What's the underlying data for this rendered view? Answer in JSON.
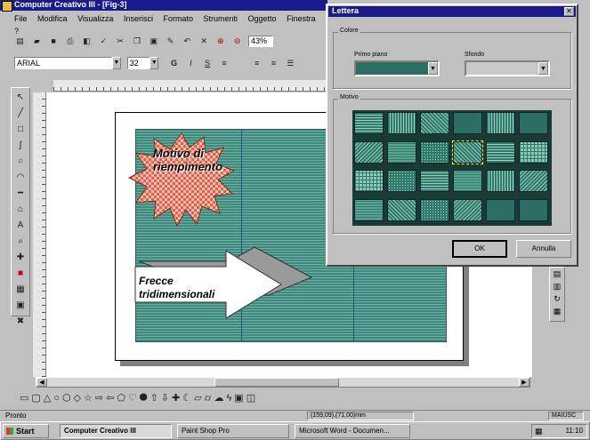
{
  "app": {
    "title": "Computer Creativo III - [Fig-3]",
    "menu": [
      "File",
      "Modifica",
      "Visualizza",
      "Inserisci",
      "Formato",
      "Strumenti",
      "Oggetto",
      "Finestra",
      "?"
    ],
    "zoom": "43%",
    "font_name": "ARIAL",
    "font_size": "32",
    "format_buttons": [
      "G",
      "I",
      "S"
    ]
  },
  "canvas": {
    "callout_text": "Motivo di riempimento",
    "arrow_text": "Frecce tridimensionali"
  },
  "dialog": {
    "title": "Lettera",
    "colors_group": "Colore",
    "foreground_label": "Primo piano",
    "background_label": "Sfondo",
    "pattern_group": "Motivo",
    "ok_label": "OK",
    "cancel_label": "Annulla",
    "patterns": [
      "p1",
      "p2",
      "p3",
      "p4",
      "p2",
      "p4",
      "p5",
      "p6",
      "p7",
      "p3",
      "p1",
      "p8",
      "p8",
      "p7",
      "p1",
      "p6",
      "p2",
      "p5",
      "p6",
      "p3",
      "p7",
      "p5",
      "p4",
      "p4"
    ]
  },
  "statusbar": {
    "left": "Pronto",
    "coords": "(159,09),(71,00)mm",
    "mode": "MAIUSC"
  },
  "taskbar": {
    "start_label": "Start",
    "tasks": [
      "Computer Creativo III",
      "Paint Shop Pro",
      "Microsoft Word - Documen..."
    ],
    "clock": "11:10"
  },
  "colors": {
    "title_bar": "#1a1a8c",
    "canvas_teal": "#4f9a8c",
    "dialog_selected": "#6f9ee8"
  },
  "icons": {
    "ruler": "ruler-icon",
    "draw_tools": [
      "pointer-icon",
      "line-icon",
      "rectangle-icon",
      "polyline-icon",
      "ellipse-icon",
      "arc-icon",
      "line-style-icon",
      "shape-icon",
      "text-icon",
      "zoom-icon",
      "dropper-icon",
      "color-fill-icon",
      "pattern-icon",
      "picture-icon",
      "wrench-icon"
    ],
    "shape_bar": [
      "rect-shape-icon",
      "rounded-rect-shape-icon",
      "triangle-shape-icon",
      "circle-shape-icon",
      "hexagon-shape-icon",
      "diamond-shape-icon",
      "star-shape-icon",
      "arrow-right-shape-icon",
      "arrow-left-shape-icon",
      "pentagon-shape-icon",
      "heart-shape-icon"
    ]
  }
}
